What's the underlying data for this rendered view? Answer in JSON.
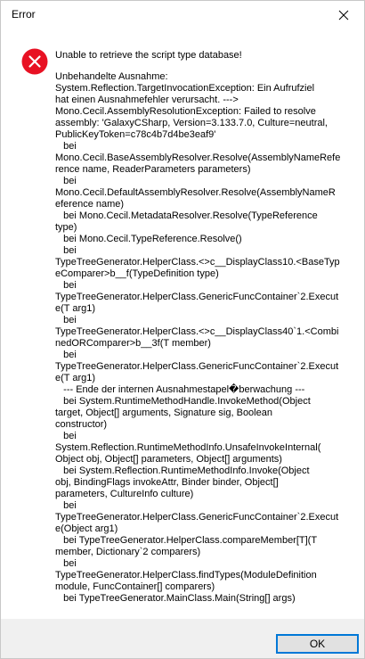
{
  "window": {
    "title": "Error",
    "close_icon": "close-icon"
  },
  "message": {
    "icon": "error-icon",
    "headline": "Unable to retrieve the script type database!",
    "body": "Unbehandelte Ausnahme:\nSystem.Reflection.TargetInvocationException: Ein Aufrufziel\nhat einen Ausnahmefehler verursacht. --->\nMono.Cecil.AssemblyResolutionException: Failed to resolve\nassembly: 'GalaxyCSharp, Version=3.133.7.0, Culture=neutral,\nPublicKeyToken=c78c4b7d4be3eaf9'\n   bei\nMono.Cecil.BaseAssemblyResolver.Resolve(AssemblyNameRefe\nrence name, ReaderParameters parameters)\n   bei\nMono.Cecil.DefaultAssemblyResolver.Resolve(AssemblyNameR\neference name)\n   bei Mono.Cecil.MetadataResolver.Resolve(TypeReference\ntype)\n   bei Mono.Cecil.TypeReference.Resolve()\n   bei\nTypeTreeGenerator.HelperClass.<>c__DisplayClass10.<BaseTyp\neComparer>b__f(TypeDefinition type)\n   bei\nTypeTreeGenerator.HelperClass.GenericFuncContainer`2.Execut\ne(T arg1)\n   bei\nTypeTreeGenerator.HelperClass.<>c__DisplayClass40`1.<Combi\nnedORComparer>b__3f(T member)\n   bei\nTypeTreeGenerator.HelperClass.GenericFuncContainer`2.Execut\ne(T arg1)\n   --- Ende der internen Ausnahmestapel�berwachung ---\n   bei System.RuntimeMethodHandle.InvokeMethod(Object\ntarget, Object[] arguments, Signature sig, Boolean\nconstructor)\n   bei\nSystem.Reflection.RuntimeMethodInfo.UnsafeInvokeInternal(\nObject obj, Object[] parameters, Object[] arguments)\n   bei System.Reflection.RuntimeMethodInfo.Invoke(Object\nobj, BindingFlags invokeAttr, Binder binder, Object[]\nparameters, CultureInfo culture)\n   bei\nTypeTreeGenerator.HelperClass.GenericFuncContainer`2.Execut\ne(Object arg1)\n   bei TypeTreeGenerator.HelperClass.compareMember[T](T\nmember, Dictionary`2 comparers)\n   bei\nTypeTreeGenerator.HelperClass.findTypes(ModuleDefinition\nmodule, FuncContainer[] comparers)\n   bei TypeTreeGenerator.MainClass.Main(String[] args)"
  },
  "buttons": {
    "ok_label": "OK"
  },
  "colors": {
    "error_red": "#e81123",
    "footer_bg": "#f0f0f0",
    "button_accent": "#0078d7"
  }
}
